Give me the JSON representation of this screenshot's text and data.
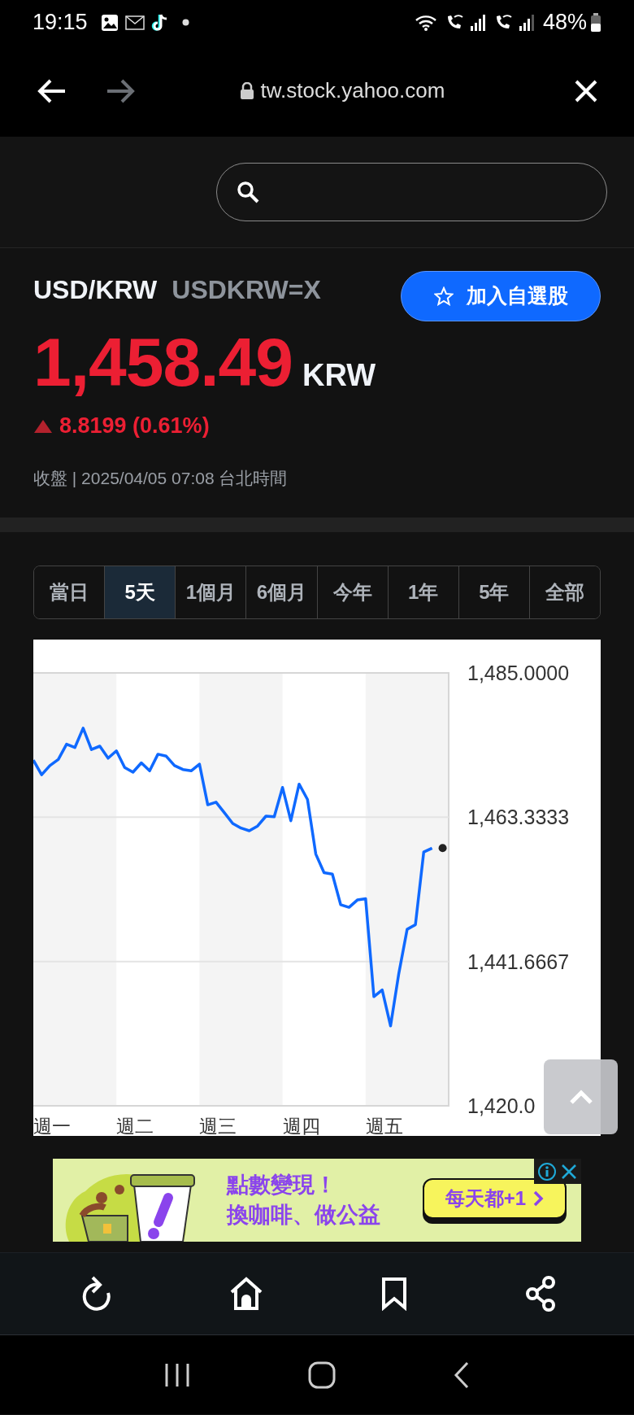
{
  "status_bar": {
    "time": "19:15",
    "battery": "48%"
  },
  "browser": {
    "url": "tw.stock.yahoo.com",
    "forward_disabled": true
  },
  "quote": {
    "name": "USD/KRW",
    "symbol": "USDKRW=X",
    "watch_button": "加入自選股",
    "price": "1,458.49",
    "currency": "KRW",
    "change_up": true,
    "change": "8.8199 (0.61%)",
    "status": "收盤 | 2025/04/05 07:08 台北時間"
  },
  "range_tabs": [
    {
      "label": "當日",
      "selected": false
    },
    {
      "label": "5天",
      "selected": true
    },
    {
      "label": "1個月",
      "selected": false
    },
    {
      "label": "6個月",
      "selected": false
    },
    {
      "label": "今年",
      "selected": false
    },
    {
      "label": "1年",
      "selected": false
    },
    {
      "label": "5年",
      "selected": false
    },
    {
      "label": "全部",
      "selected": false
    }
  ],
  "chart": {
    "chart_data": {
      "type": "line",
      "categories": [
        null,
        null,
        "週一",
        null,
        null,
        null,
        null,
        null,
        null,
        null,
        null,
        null,
        "週二",
        null,
        null,
        null,
        null,
        null,
        null,
        null,
        null,
        null,
        "週三",
        null,
        null,
        null,
        null,
        null,
        null,
        null,
        null,
        null,
        "週四",
        null,
        null,
        null,
        null,
        null,
        null,
        null,
        null,
        null,
        "週五",
        null,
        null,
        null,
        null,
        null,
        null
      ],
      "series": [
        {
          "color": "#0f69ff",
          "values": [
            1471.9,
            1469.7,
            1471.1,
            1472,
            1474.3,
            1473.8,
            1476.7,
            1473.5,
            1474,
            1472.2,
            1473.3,
            1470.8,
            1470.1,
            1471.5,
            1470.3,
            1472.8,
            1472.5,
            1471.1,
            1470.5,
            1470.3,
            1471.3,
            1465.2,
            1465.6,
            1464,
            1462.4,
            1461.7,
            1461.3,
            1462,
            1463.5,
            1463.4,
            1467.8,
            1462.8,
            1468.3,
            1466,
            1457.8,
            1455,
            1454.8,
            1450.2,
            1449.8,
            1450.9,
            1451.1,
            1436.4,
            1437.4,
            1432,
            1439.9,
            1446.5,
            1447.2,
            1458.1,
            1458.7
          ]
        }
      ],
      "ylim": [
        1420,
        1485
      ],
      "yticks": [
        {
          "value": 1485,
          "label": "1,485.0000"
        },
        {
          "value": 1463.3333,
          "label": "1,463.3333"
        },
        {
          "value": 1441.6667,
          "label": "1,441.6667"
        },
        {
          "value": 1420,
          "label": "1,420.0"
        }
      ]
    }
  },
  "ad": {
    "headline": "點數變現！",
    "subline": "換咖啡、做公益",
    "button": "每天都+1"
  }
}
